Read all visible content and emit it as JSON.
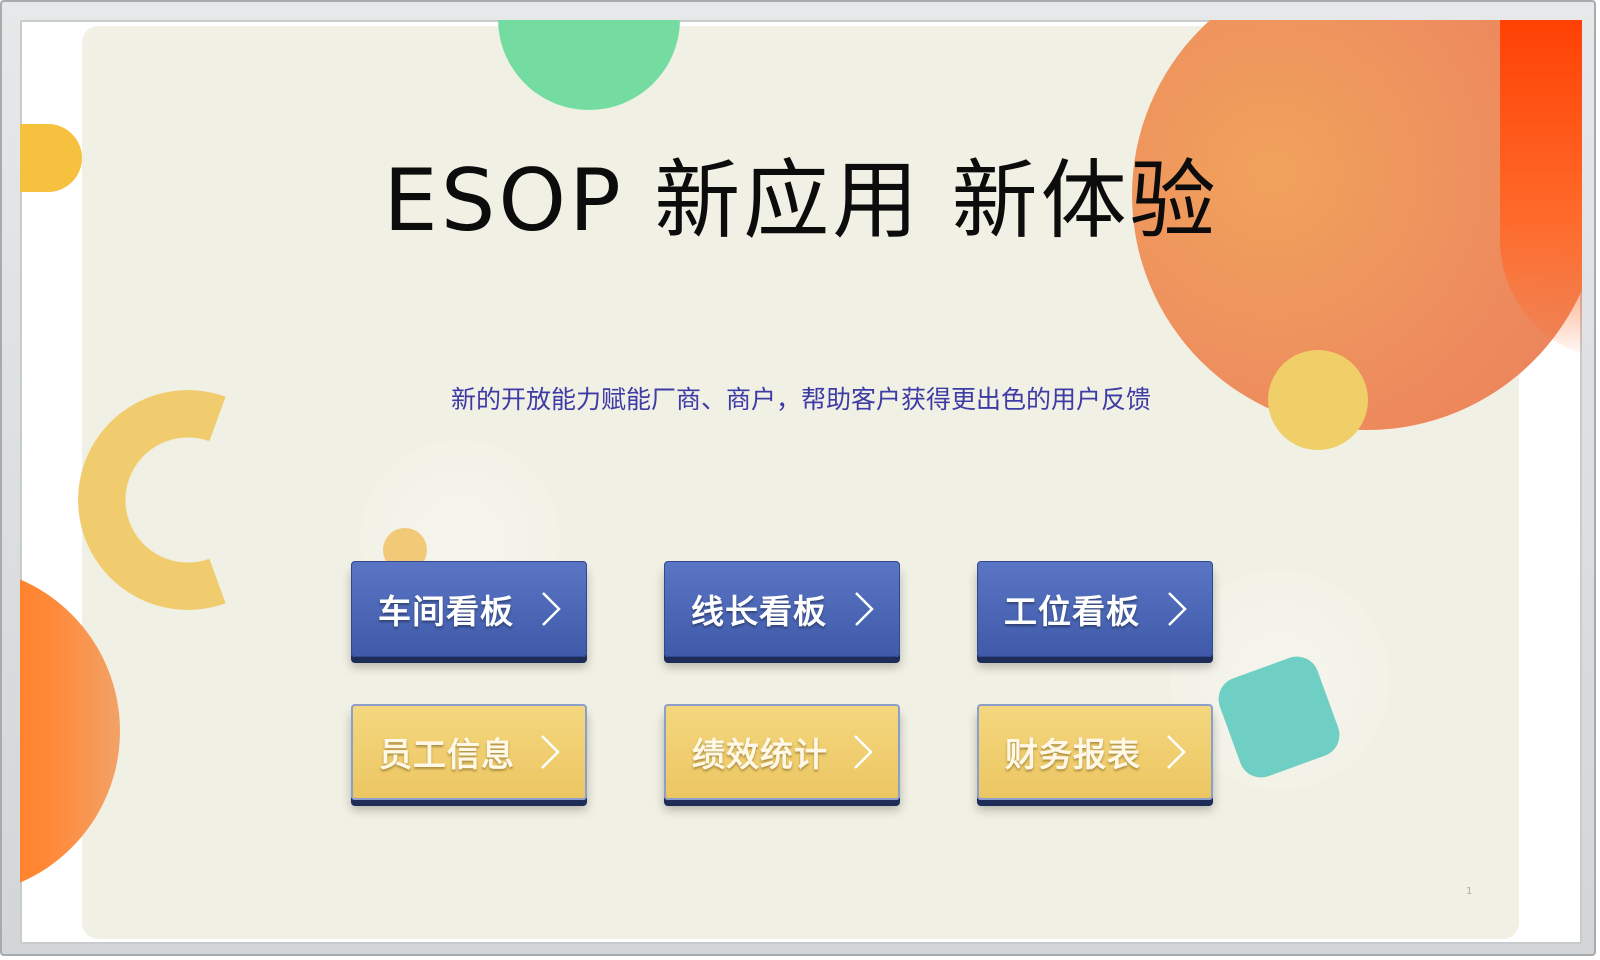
{
  "slide": {
    "title": "ESOP 新应用 新体验",
    "subtitle": "新的开放能力赋能厂商、商户，帮助客户获得更出色的用户反馈",
    "page_number": "1"
  },
  "buttons": [
    {
      "label": "车间看板",
      "style": "blue",
      "icon": "chevron-right-icon"
    },
    {
      "label": "线长看板",
      "style": "blue",
      "icon": "chevron-right-icon"
    },
    {
      "label": "工位看板",
      "style": "blue",
      "icon": "chevron-right-icon"
    },
    {
      "label": "员工信息",
      "style": "yellow",
      "icon": "chevron-right-icon"
    },
    {
      "label": "绩效统计",
      "style": "yellow",
      "icon": "chevron-right-icon"
    },
    {
      "label": "财务报表",
      "style": "yellow",
      "icon": "chevron-right-icon"
    }
  ],
  "colors": {
    "panel_bg": "#f1f0e4",
    "title": "#0c0c0c",
    "subtitle": "#3d3ba6",
    "button_blue": "#4a66b6",
    "button_yellow": "#f0cd6c",
    "accent_orange": "#ee8d5e",
    "accent_green": "#74dca0",
    "accent_teal": "#6fcfc4"
  }
}
